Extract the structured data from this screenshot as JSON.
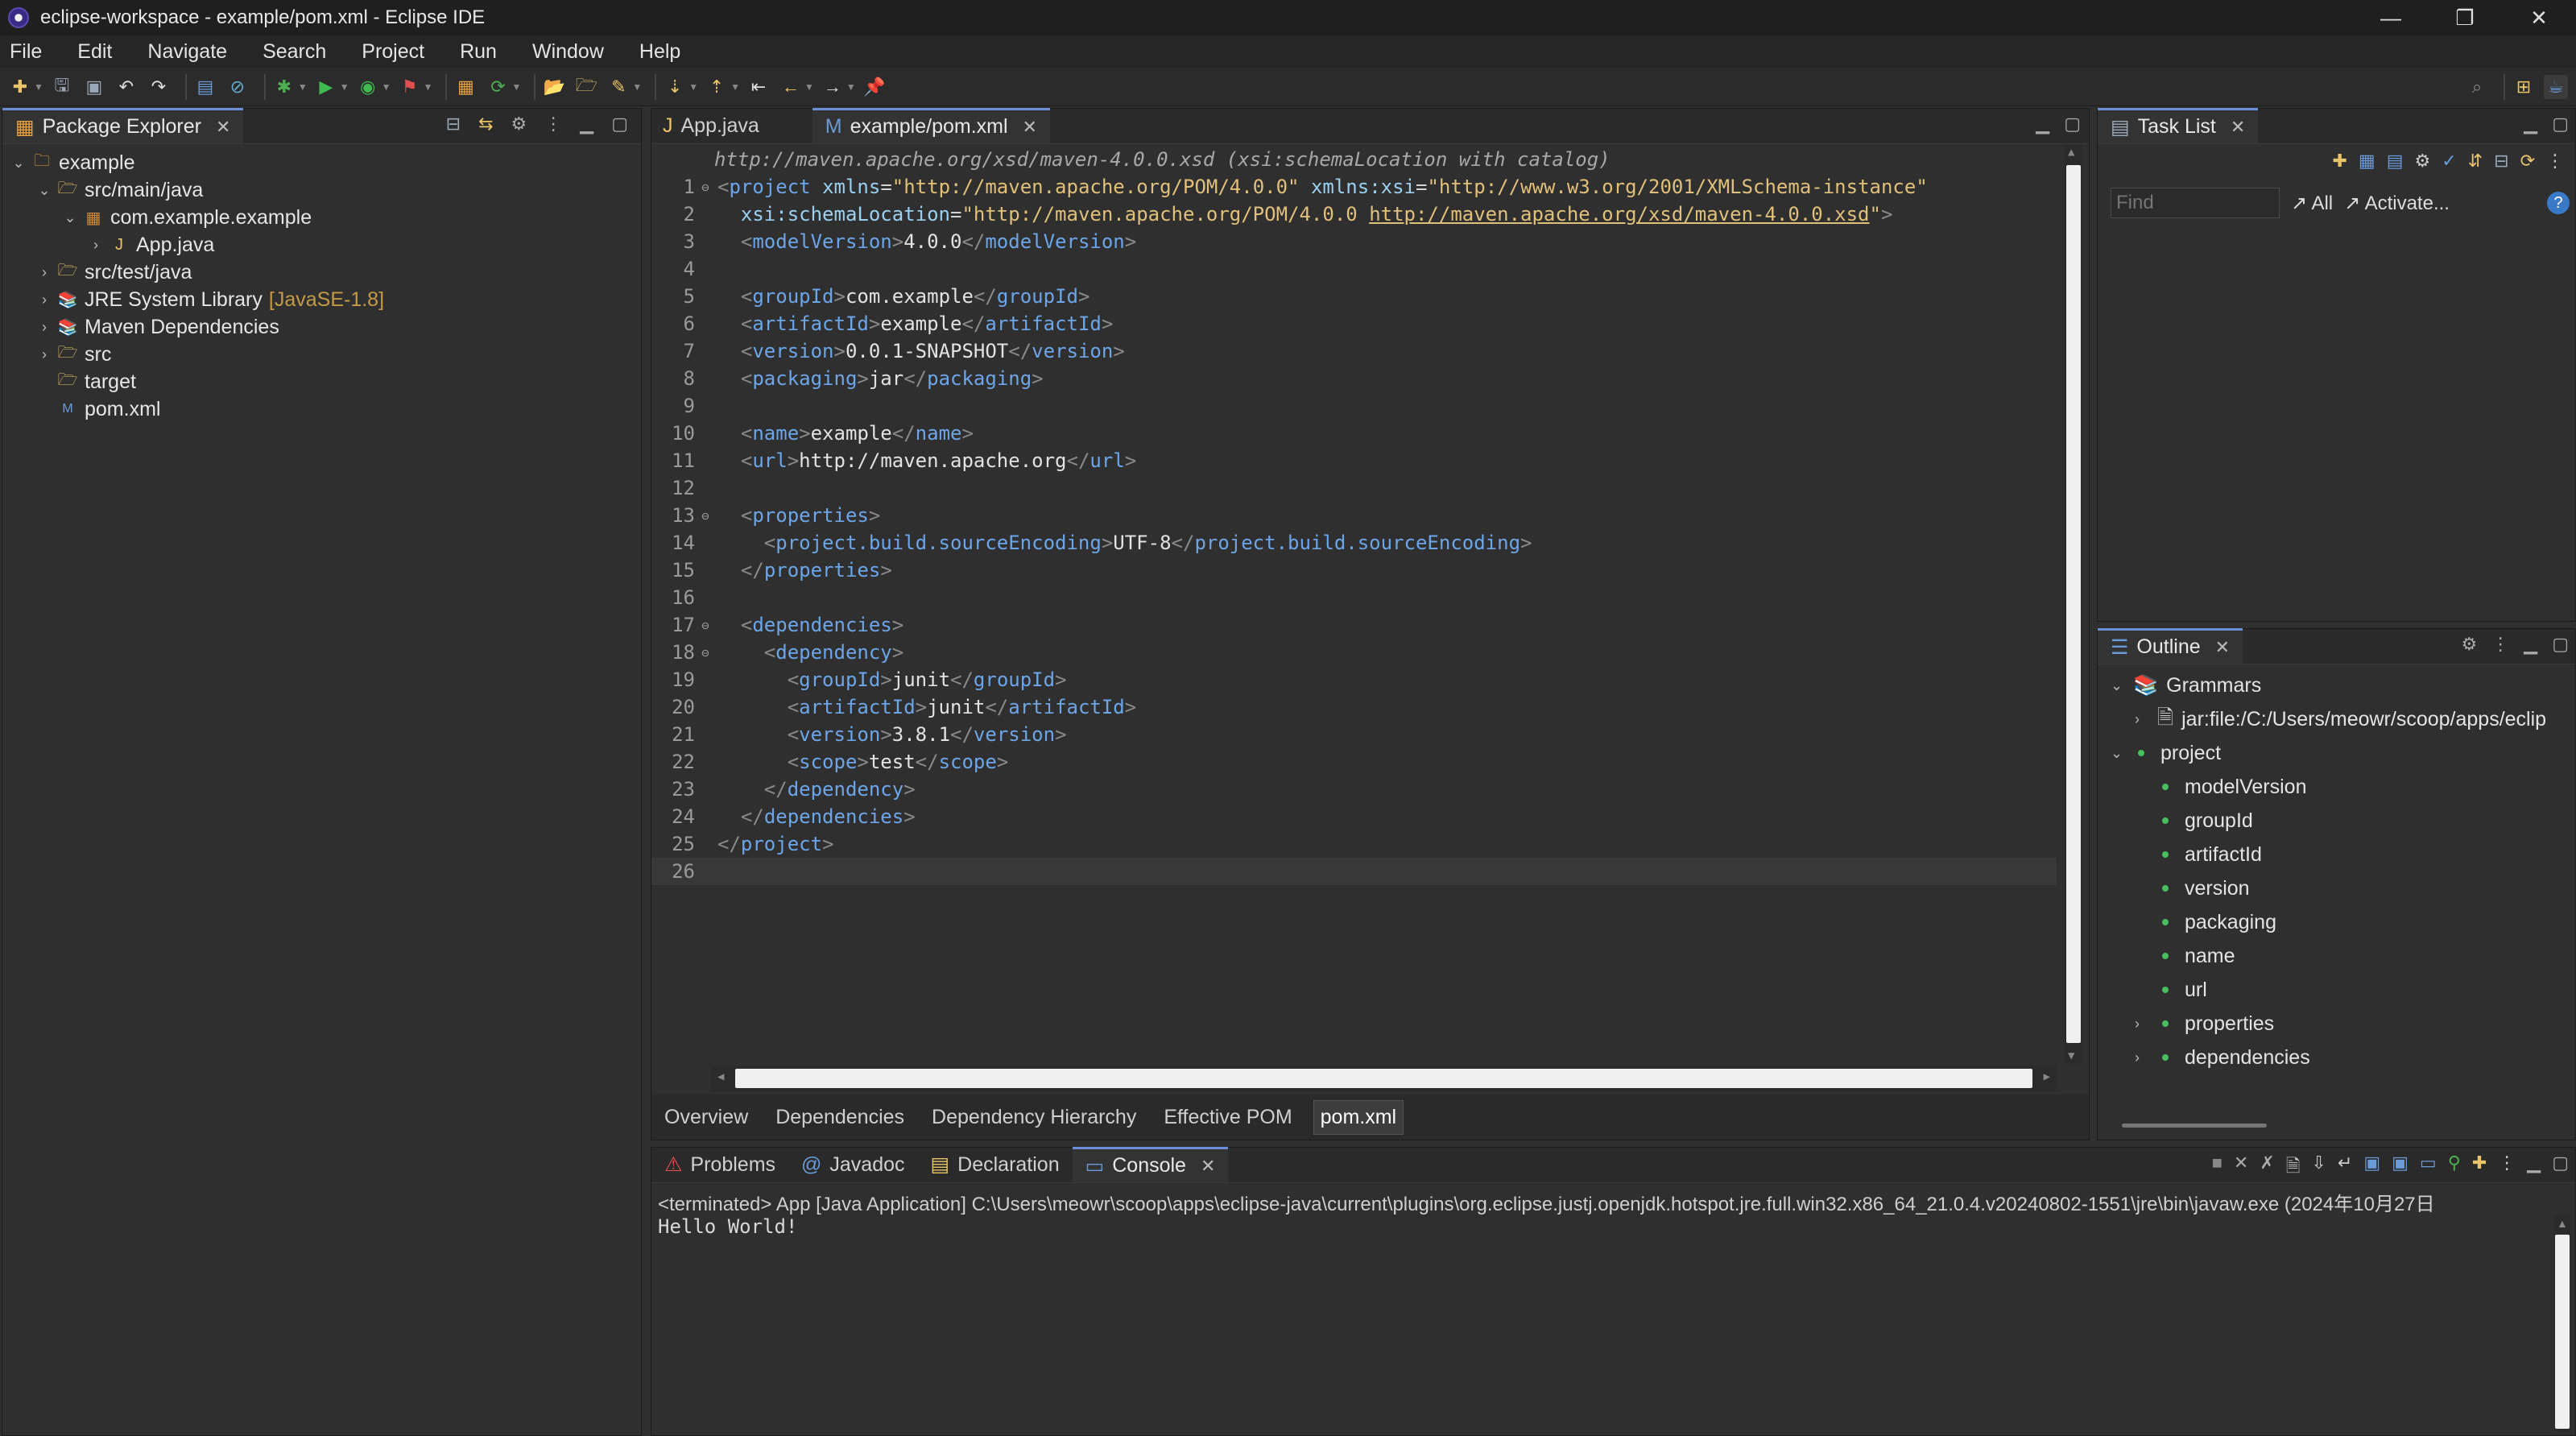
{
  "window": {
    "title": "eclipse-workspace - example/pom.xml - Eclipse IDE",
    "minimize": "—",
    "restore": "❐",
    "close": "✕"
  },
  "menu": [
    "File",
    "Edit",
    "Navigate",
    "Search",
    "Project",
    "Run",
    "Window",
    "Help"
  ],
  "package_explorer": {
    "title": "Package Explorer",
    "items": [
      {
        "label": "example",
        "deco": ""
      },
      {
        "label": "src/main/java",
        "deco": ""
      },
      {
        "label": "com.example.example",
        "deco": ""
      },
      {
        "label": "App.java",
        "deco": ""
      },
      {
        "label": "src/test/java",
        "deco": ""
      },
      {
        "label": "JRE System Library",
        "deco": "[JavaSE-1.8]"
      },
      {
        "label": "Maven Dependencies",
        "deco": ""
      },
      {
        "label": "src",
        "deco": ""
      },
      {
        "label": "target",
        "deco": ""
      },
      {
        "label": "pom.xml",
        "deco": ""
      }
    ]
  },
  "editor": {
    "tabs": [
      {
        "label": "App.java"
      },
      {
        "label": "example/pom.xml"
      }
    ],
    "schema_hint": "http://maven.apache.org/xsd/maven-4.0.0.xsd (xsi:schemaLocation with catalog)",
    "line_numbers": [
      "1",
      "2",
      "3",
      "4",
      "5",
      "6",
      "7",
      "8",
      "9",
      "10",
      "11",
      "12",
      "13",
      "14",
      "15",
      "16",
      "17",
      "18",
      "19",
      "20",
      "21",
      "22",
      "23",
      "24",
      "25",
      "26"
    ],
    "lines": {
      "l1": {
        "tag": "project",
        "a1": "xmlns",
        "v1": "\"http://maven.apache.org/POM/4.0.0\"",
        "a2": "xmlns:xsi",
        "v2": "\"http://www.w3.org/2001/XMLSchema-instance\""
      },
      "l2": {
        "attr": "xsi:schemaLocation",
        "v_plain": "\"http://maven.apache.org/POM/4.0.0 ",
        "v_link": "http://maven.apache.org/xsd/maven-4.0.0.xsd",
        "v_end": "\""
      },
      "l3": {
        "tag": "modelVersion",
        "text": "4.0.0"
      },
      "l5": {
        "tag": "groupId",
        "text": "com.example"
      },
      "l6": {
        "tag": "artifactId",
        "text": "example"
      },
      "l7": {
        "tag": "version",
        "text": "0.0.1-SNAPSHOT"
      },
      "l8": {
        "tag": "packaging",
        "text": "jar"
      },
      "l10": {
        "tag": "name",
        "text": "example"
      },
      "l11": {
        "tag": "url",
        "text": "http://maven.apache.org"
      },
      "l13": {
        "tag": "properties"
      },
      "l14": {
        "tag": "project.build.sourceEncoding",
        "text": "UTF-8"
      },
      "l15": {
        "tag": "properties"
      },
      "l17": {
        "tag": "dependencies"
      },
      "l18": {
        "tag": "dependency"
      },
      "l19": {
        "tag": "groupId",
        "text": "junit"
      },
      "l20": {
        "tag": "artifactId",
        "text": "junit"
      },
      "l21": {
        "tag": "version",
        "text": "3.8.1"
      },
      "l22": {
        "tag": "scope",
        "text": "test"
      },
      "l23": {
        "tag": "dependency"
      },
      "l24": {
        "tag": "dependencies"
      },
      "l25": {
        "tag": "project"
      }
    },
    "bottom_tabs": [
      "Overview",
      "Dependencies",
      "Dependency Hierarchy",
      "Effective POM",
      "pom.xml"
    ]
  },
  "task_list": {
    "title": "Task List",
    "find_placeholder": "Find",
    "all": "All",
    "activate": "Activate..."
  },
  "outline": {
    "title": "Outline",
    "items": [
      {
        "label": "Grammars"
      },
      {
        "label": "jar:file:/C:/Users/meowr/scoop/apps/eclip"
      },
      {
        "label": "project"
      },
      {
        "label": "modelVersion"
      },
      {
        "label": "groupId"
      },
      {
        "label": "artifactId"
      },
      {
        "label": "version"
      },
      {
        "label": "packaging"
      },
      {
        "label": "name"
      },
      {
        "label": "url"
      },
      {
        "label": "properties"
      },
      {
        "label": "dependencies"
      }
    ]
  },
  "console_panel": {
    "tabs": [
      "Problems",
      "Javadoc",
      "Declaration",
      "Console"
    ],
    "status": "<terminated> App [Java Application] C:\\Users\\meowr\\scoop\\apps\\eclipse-java\\current\\plugins\\org.eclipse.justj.openjdk.hotspot.jre.full.win32.x86_64_21.0.4.v20240802-1551\\jre\\bin\\javaw.exe  (2024年10月27日",
    "output": "Hello World!"
  },
  "colors": {
    "accent": "#6a8fd8",
    "xml_tag": "#6da6e8",
    "xml_value": "#e0c07a",
    "outline_dot": "#48c060"
  }
}
